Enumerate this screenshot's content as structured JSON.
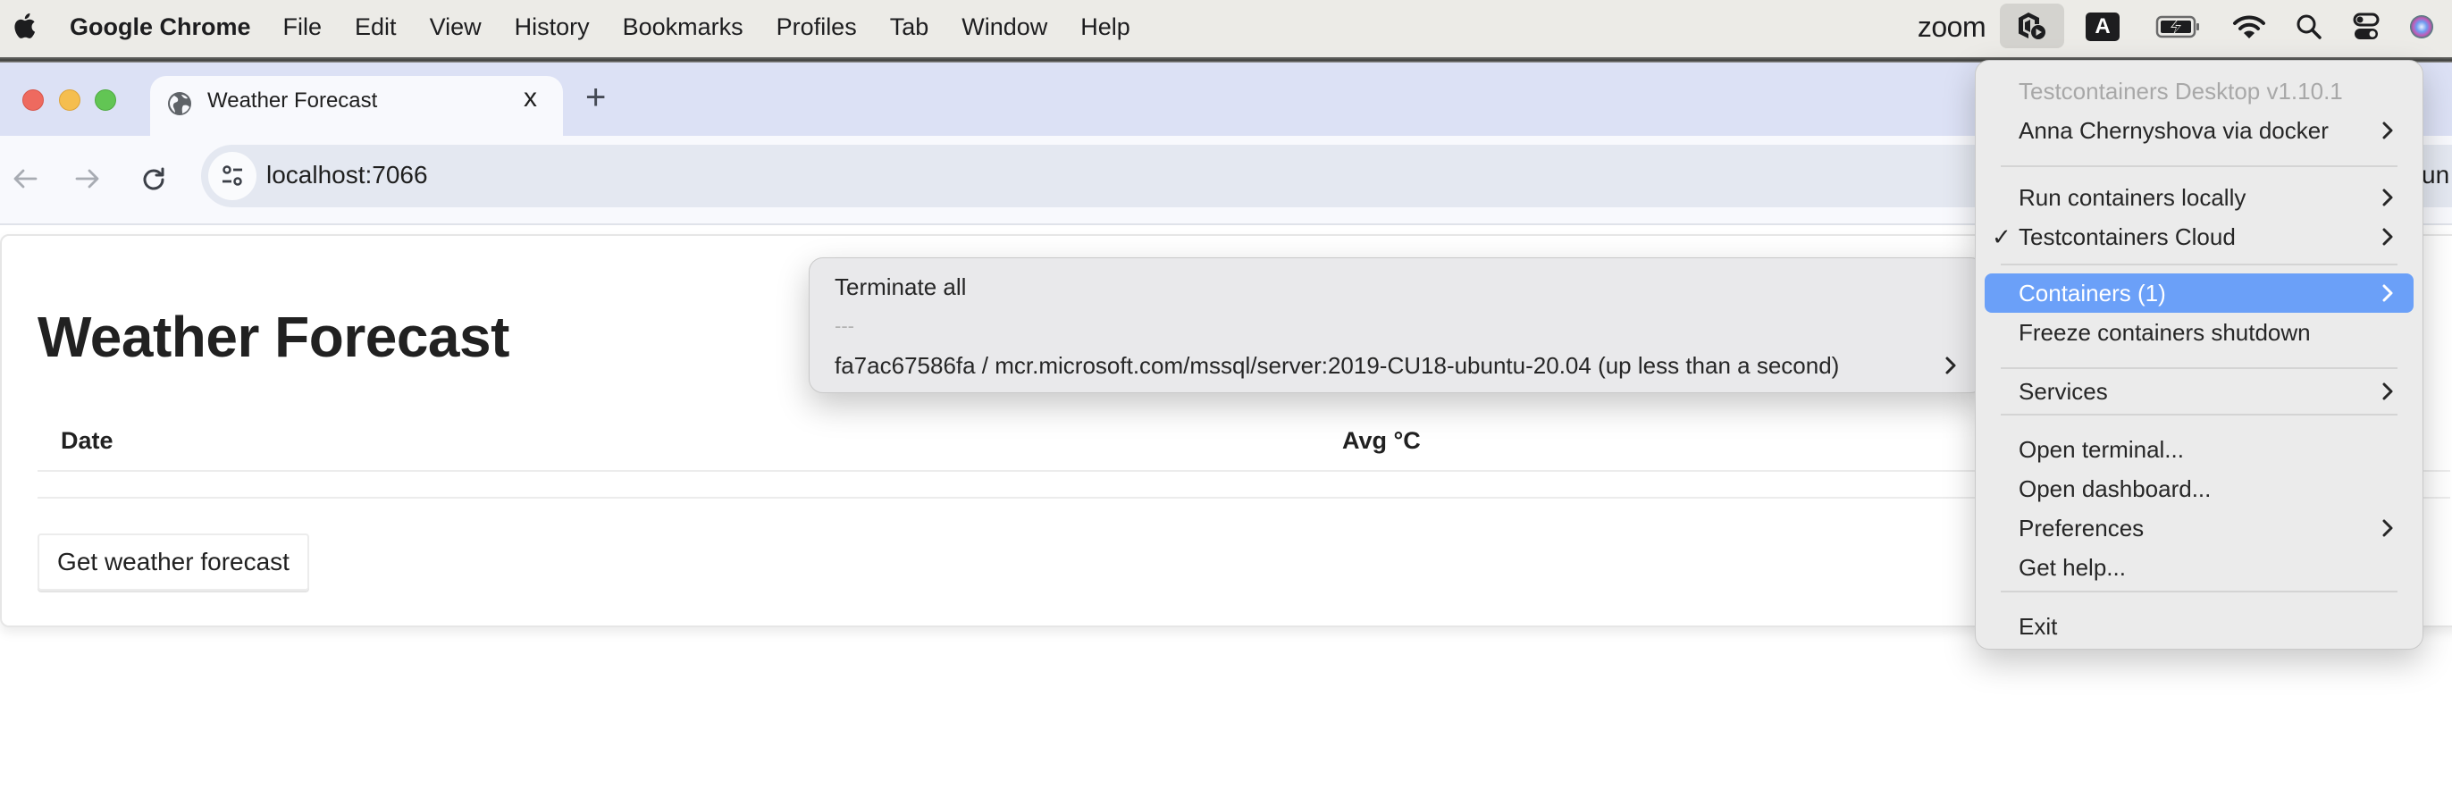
{
  "menubar": {
    "app_name": "Google Chrome",
    "items": [
      "File",
      "Edit",
      "View",
      "History",
      "Bookmarks",
      "Profiles",
      "Tab",
      "Window",
      "Help"
    ],
    "status_icons": [
      "zoom-icon",
      "testcontainers-icon",
      "input-source-icon",
      "battery-charging-icon",
      "wifi-icon",
      "spotlight-search-icon",
      "control-center-icon",
      "siri-icon"
    ],
    "zoom_label": "zoom",
    "input_source_label": "A"
  },
  "browser": {
    "tab": {
      "title": "Weather Forecast",
      "close": "x"
    },
    "new_tab": "+",
    "url": "localhost:7066",
    "right_chip_partial": "un"
  },
  "page": {
    "title": "Weather Forecast",
    "table": {
      "headers": [
        "Date",
        "Avg °C"
      ],
      "rows": []
    },
    "fetch_button": "Get weather forecast"
  },
  "tray_menu": {
    "header": "Testcontainers Desktop v1.10.1",
    "items": [
      {
        "label": "Anna Chernyshova via docker",
        "submenu": true
      },
      {
        "label": "Run containers locally",
        "submenu": true
      },
      {
        "label": "Testcontainers Cloud",
        "submenu": true,
        "checked": true
      },
      {
        "label": "Containers (1)",
        "submenu": true,
        "highlighted": true
      },
      {
        "label": "Freeze containers shutdown",
        "submenu": false
      },
      {
        "label": "Services",
        "submenu": true
      },
      {
        "label": "Open terminal...",
        "submenu": false
      },
      {
        "label": "Open dashboard...",
        "submenu": false
      },
      {
        "label": "Preferences",
        "submenu": true
      },
      {
        "label": "Get help...",
        "submenu": false
      },
      {
        "label": "Exit",
        "submenu": false
      }
    ],
    "check_glyph": "✓"
  },
  "containers_submenu": {
    "terminate_all": "Terminate all",
    "divider_text": "---",
    "containers": [
      {
        "label": "fa7ac67586fa / mcr.microsoft.com/mssql/server:2019-CU18-ubuntu-20.04 (up less than a second)",
        "submenu": true
      }
    ]
  },
  "colors": {
    "highlight": "#6ba0f8",
    "tabstrip": "#dce1f5",
    "omnibox": "#e4e8f1",
    "traffic_close": "#ee6a5f",
    "traffic_minimize": "#f5be4f",
    "traffic_zoom": "#62c554"
  }
}
